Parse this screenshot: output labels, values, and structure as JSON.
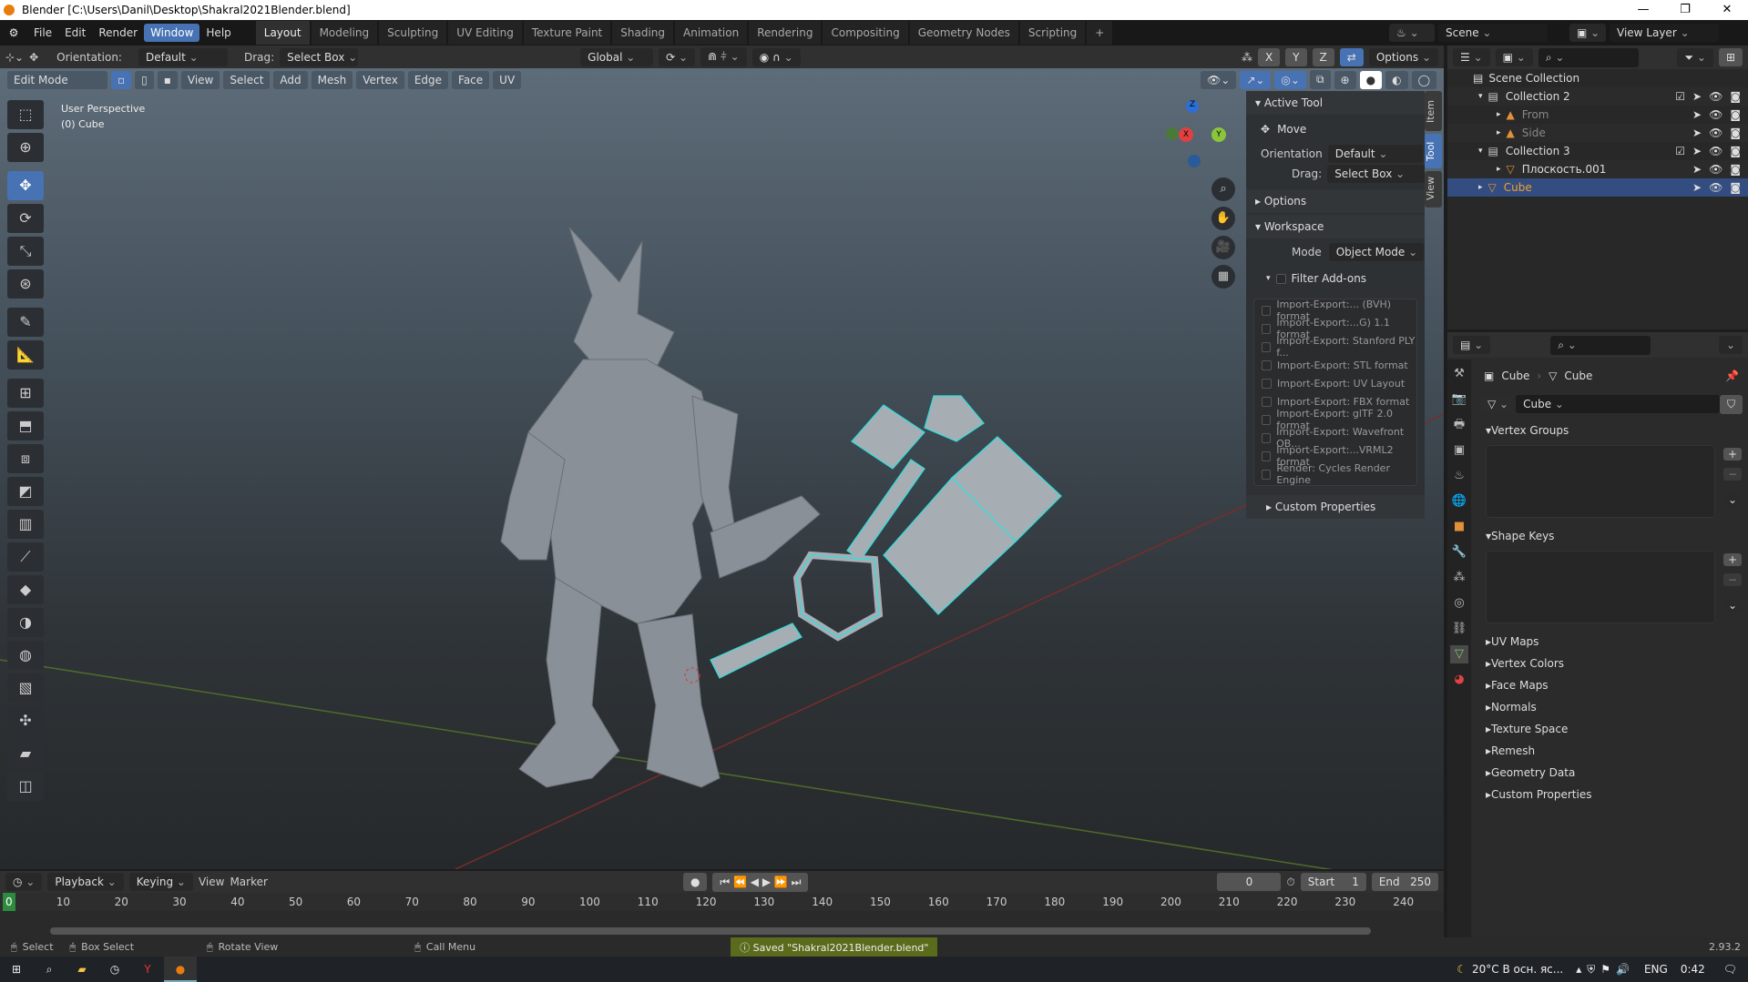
{
  "window": {
    "title": "Blender [C:\\Users\\Danil\\Desktop\\Shakral2021Blender.blend]",
    "controls": [
      "—",
      "❐",
      "✕"
    ]
  },
  "menu": [
    "File",
    "Edit",
    "Render",
    "Window",
    "Help"
  ],
  "active_menu": "Window",
  "workspaces": [
    "Layout",
    "Modeling",
    "Sculpting",
    "UV Editing",
    "Texture Paint",
    "Shading",
    "Animation",
    "Rendering",
    "Compositing",
    "Geometry Nodes",
    "Scripting",
    "+"
  ],
  "scene": {
    "scene_name": "Scene",
    "view_layer": "View Layer"
  },
  "tool_header": {
    "orientation_label": "Orientation:",
    "orientation_value": "Default",
    "drag_label": "Drag:",
    "drag_value": "Select Box",
    "transform": "Global",
    "axes": [
      "X",
      "Y",
      "Z"
    ],
    "options": "Options"
  },
  "viewport_header": {
    "mode": "Edit Mode",
    "menus": [
      "View",
      "Select",
      "Add",
      "Mesh",
      "Vertex",
      "Edge",
      "Face",
      "UV"
    ]
  },
  "viewport": {
    "perspective": "User Perspective",
    "object": "(0) Cube",
    "gizmo": {
      "z": "Z",
      "y": "Y",
      "x": "X"
    }
  },
  "toolbar_icons": [
    "select-box",
    "cursor",
    "move",
    "rotate",
    "scale",
    "transform",
    "annotate",
    "measure",
    "add-cube",
    "extrude",
    "inset",
    "bevel",
    "loop-cut",
    "knife",
    "poly-build",
    "spin",
    "smooth",
    "edge-slide",
    "shrink-fatten",
    "shear",
    "rip"
  ],
  "npanel": {
    "tabs": [
      "Item",
      "Tool",
      "View"
    ],
    "active_tab": "Tool",
    "active_tool_title": "Active Tool",
    "tool_name": "Move",
    "orientation_label": "Orientation",
    "orientation_value": "Default",
    "drag_label": "Drag:",
    "drag_value": "Select Box",
    "options": "Options",
    "workspace": "Workspace",
    "mode_label": "Mode",
    "mode_value": "Object Mode",
    "filter_addons": "Filter Add-ons",
    "addons": [
      "Import-Export:... (BVH) format",
      "Import-Export:...G) 1.1 format",
      "Import-Export: Stanford PLY f...",
      "Import-Export: STL format",
      "Import-Export: UV Layout",
      "Import-Export: FBX format",
      "Import-Export: glTF 2.0 format",
      "Import-Export: Wavefront OB...",
      "Import-Export:...VRML2 format",
      "Render: Cycles Render Engine"
    ],
    "custom_properties": "Custom Properties"
  },
  "outliner": {
    "root": "Scene Collection",
    "rows": [
      {
        "name": "Collection 2",
        "indent": 1
      },
      {
        "name": "From",
        "indent": 2
      },
      {
        "name": "Side",
        "indent": 2
      },
      {
        "name": "Collection 3",
        "indent": 1
      },
      {
        "name": "Плоскость.001",
        "indent": 2
      },
      {
        "name": "Cube",
        "indent": 1,
        "selected": true
      }
    ]
  },
  "properties": {
    "breadcrumb_object": "Cube",
    "breadcrumb_data": "Cube",
    "mesh_name": "Cube",
    "sections": [
      "Vertex Groups",
      "Shape Keys",
      "UV Maps",
      "Vertex Colors",
      "Face Maps",
      "Normals",
      "Texture Space",
      "Remesh",
      "Geometry Data",
      "Custom Properties"
    ]
  },
  "timeline": {
    "menus": [
      "Playback",
      "Keying",
      "View",
      "Marker"
    ],
    "current_frame": "0",
    "start_label": "Start",
    "start": "1",
    "end_label": "End",
    "end": "250",
    "ticks": [
      "0",
      "10",
      "20",
      "30",
      "40",
      "50",
      "60",
      "70",
      "80",
      "90",
      "100",
      "110",
      "120",
      "130",
      "140",
      "150",
      "160",
      "170",
      "180",
      "190",
      "200",
      "210",
      "220",
      "230",
      "240"
    ]
  },
  "status": {
    "select": "Select",
    "box_select": "Box Select",
    "rotate": "Rotate View",
    "call_menu": "Call Menu",
    "message": "Saved \"Shakral2021Blender.blend\"",
    "version": "2.93.2"
  },
  "taskbar": {
    "weather": "20°C  В осн. яс...",
    "lang": "ENG",
    "time": "0:42"
  },
  "colors": {
    "accent": "#4772b3",
    "selected_object": "#f0a030",
    "saved_bg": "#5a6b1c"
  }
}
